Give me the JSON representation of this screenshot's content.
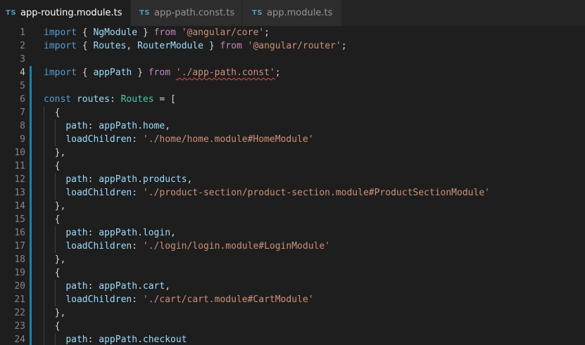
{
  "tabs": [
    {
      "icon": "TS",
      "label": "app-routing.module.ts",
      "active": true,
      "dirty": true
    },
    {
      "icon": "TS",
      "label": "app-path.const.ts",
      "active": false,
      "dirty": false
    },
    {
      "icon": "TS",
      "label": "app.module.ts",
      "active": false,
      "dirty": false
    }
  ],
  "colors": {
    "background": "#1e1e1e",
    "keyword": "#569cd6",
    "control_keyword": "#c586c0",
    "identifier": "#9cdcfe",
    "type": "#4ec9b0",
    "string": "#ce9178",
    "modified_gutter": "#1b81a8",
    "error_squiggle": "#f14c4c"
  },
  "lines": [
    {
      "n": "1",
      "tokens": [
        [
          "kw",
          "import"
        ],
        [
          "pn",
          " { "
        ],
        [
          "id",
          "NgModule"
        ],
        [
          "pn",
          " } "
        ],
        [
          "kw-ctrl",
          "from"
        ],
        [
          "pn",
          " "
        ],
        [
          "str",
          "'@angular/core'"
        ],
        [
          "pn",
          ";"
        ]
      ]
    },
    {
      "n": "2",
      "tokens": [
        [
          "kw",
          "import"
        ],
        [
          "pn",
          " { "
        ],
        [
          "id",
          "Routes"
        ],
        [
          "pn",
          ", "
        ],
        [
          "id",
          "RouterModule"
        ],
        [
          "pn",
          " } "
        ],
        [
          "kw-ctrl",
          "from"
        ],
        [
          "pn",
          " "
        ],
        [
          "str",
          "'@angular/router'"
        ],
        [
          "pn",
          ";"
        ]
      ]
    },
    {
      "n": "3",
      "tokens": []
    },
    {
      "n": "4",
      "modified": true,
      "current": true,
      "tokens": [
        [
          "kw",
          "import"
        ],
        [
          "pn",
          " { "
        ],
        [
          "id",
          "appPath"
        ],
        [
          "pn",
          " } "
        ],
        [
          "kw-ctrl",
          "from"
        ],
        [
          "pn",
          " "
        ],
        [
          "str squiggle",
          "'./app-path.const'"
        ],
        [
          "pn",
          ";"
        ]
      ]
    },
    {
      "n": "5",
      "modified": true,
      "tokens": []
    },
    {
      "n": "6",
      "modified": true,
      "tokens": [
        [
          "kw",
          "const"
        ],
        [
          "pn",
          " "
        ],
        [
          "id",
          "routes"
        ],
        [
          "pn",
          ": "
        ],
        [
          "type",
          "Routes"
        ],
        [
          "pn",
          " = ["
        ]
      ]
    },
    {
      "n": "7",
      "modified": true,
      "indent": 1,
      "tokens": [
        [
          "pn",
          "  {"
        ]
      ]
    },
    {
      "n": "8",
      "modified": true,
      "indent": 2,
      "tokens": [
        [
          "pn",
          "    "
        ],
        [
          "id",
          "path"
        ],
        [
          "pn",
          ": "
        ],
        [
          "id",
          "appPath"
        ],
        [
          "pn",
          "."
        ],
        [
          "id",
          "home"
        ],
        [
          "pn",
          ","
        ]
      ]
    },
    {
      "n": "9",
      "modified": true,
      "indent": 2,
      "tokens": [
        [
          "pn",
          "    "
        ],
        [
          "id",
          "loadChildren"
        ],
        [
          "pn",
          ": "
        ],
        [
          "str",
          "'./home/home.module#HomeModule'"
        ]
      ]
    },
    {
      "n": "10",
      "modified": true,
      "indent": 1,
      "tokens": [
        [
          "pn",
          "  },"
        ]
      ]
    },
    {
      "n": "11",
      "modified": true,
      "indent": 1,
      "tokens": [
        [
          "pn",
          "  {"
        ]
      ]
    },
    {
      "n": "12",
      "modified": true,
      "indent": 2,
      "tokens": [
        [
          "pn",
          "    "
        ],
        [
          "id",
          "path"
        ],
        [
          "pn",
          ": "
        ],
        [
          "id",
          "appPath"
        ],
        [
          "pn",
          "."
        ],
        [
          "id",
          "products"
        ],
        [
          "pn",
          ","
        ]
      ]
    },
    {
      "n": "13",
      "modified": true,
      "indent": 2,
      "tokens": [
        [
          "pn",
          "    "
        ],
        [
          "id",
          "loadChildren"
        ],
        [
          "pn",
          ": "
        ],
        [
          "str",
          "'./product-section/product-section.module#ProductSectionModule'"
        ]
      ]
    },
    {
      "n": "14",
      "modified": true,
      "indent": 1,
      "tokens": [
        [
          "pn",
          "  },"
        ]
      ]
    },
    {
      "n": "15",
      "modified": true,
      "indent": 1,
      "tokens": [
        [
          "pn",
          "  {"
        ]
      ]
    },
    {
      "n": "16",
      "modified": true,
      "indent": 2,
      "tokens": [
        [
          "pn",
          "    "
        ],
        [
          "id",
          "path"
        ],
        [
          "pn",
          ": "
        ],
        [
          "id",
          "appPath"
        ],
        [
          "pn",
          "."
        ],
        [
          "id",
          "login"
        ],
        [
          "pn",
          ","
        ]
      ]
    },
    {
      "n": "17",
      "modified": true,
      "indent": 2,
      "tokens": [
        [
          "pn",
          "    "
        ],
        [
          "id",
          "loadChildren"
        ],
        [
          "pn",
          ": "
        ],
        [
          "str",
          "'./login/login.module#LoginModule'"
        ]
      ]
    },
    {
      "n": "18",
      "modified": true,
      "indent": 1,
      "tokens": [
        [
          "pn",
          "  },"
        ]
      ]
    },
    {
      "n": "19",
      "modified": true,
      "indent": 1,
      "tokens": [
        [
          "pn",
          "  {"
        ]
      ]
    },
    {
      "n": "20",
      "modified": true,
      "indent": 2,
      "tokens": [
        [
          "pn",
          "    "
        ],
        [
          "id",
          "path"
        ],
        [
          "pn",
          ": "
        ],
        [
          "id",
          "appPath"
        ],
        [
          "pn",
          "."
        ],
        [
          "id",
          "cart"
        ],
        [
          "pn",
          ","
        ]
      ]
    },
    {
      "n": "21",
      "modified": true,
      "indent": 2,
      "tokens": [
        [
          "pn",
          "    "
        ],
        [
          "id",
          "loadChildren"
        ],
        [
          "pn",
          ": "
        ],
        [
          "str",
          "'./cart/cart.module#CartModule'"
        ]
      ]
    },
    {
      "n": "22",
      "modified": true,
      "indent": 1,
      "tokens": [
        [
          "pn",
          "  },"
        ]
      ]
    },
    {
      "n": "23",
      "modified": true,
      "indent": 1,
      "tokens": [
        [
          "pn",
          "  {"
        ]
      ]
    },
    {
      "n": "24",
      "modified": true,
      "indent": 2,
      "tokens": [
        [
          "pn",
          "    "
        ],
        [
          "id",
          "path"
        ],
        [
          "pn",
          ": "
        ],
        [
          "id",
          "appPath"
        ],
        [
          "pn",
          "."
        ],
        [
          "id",
          "checkout"
        ]
      ]
    }
  ]
}
